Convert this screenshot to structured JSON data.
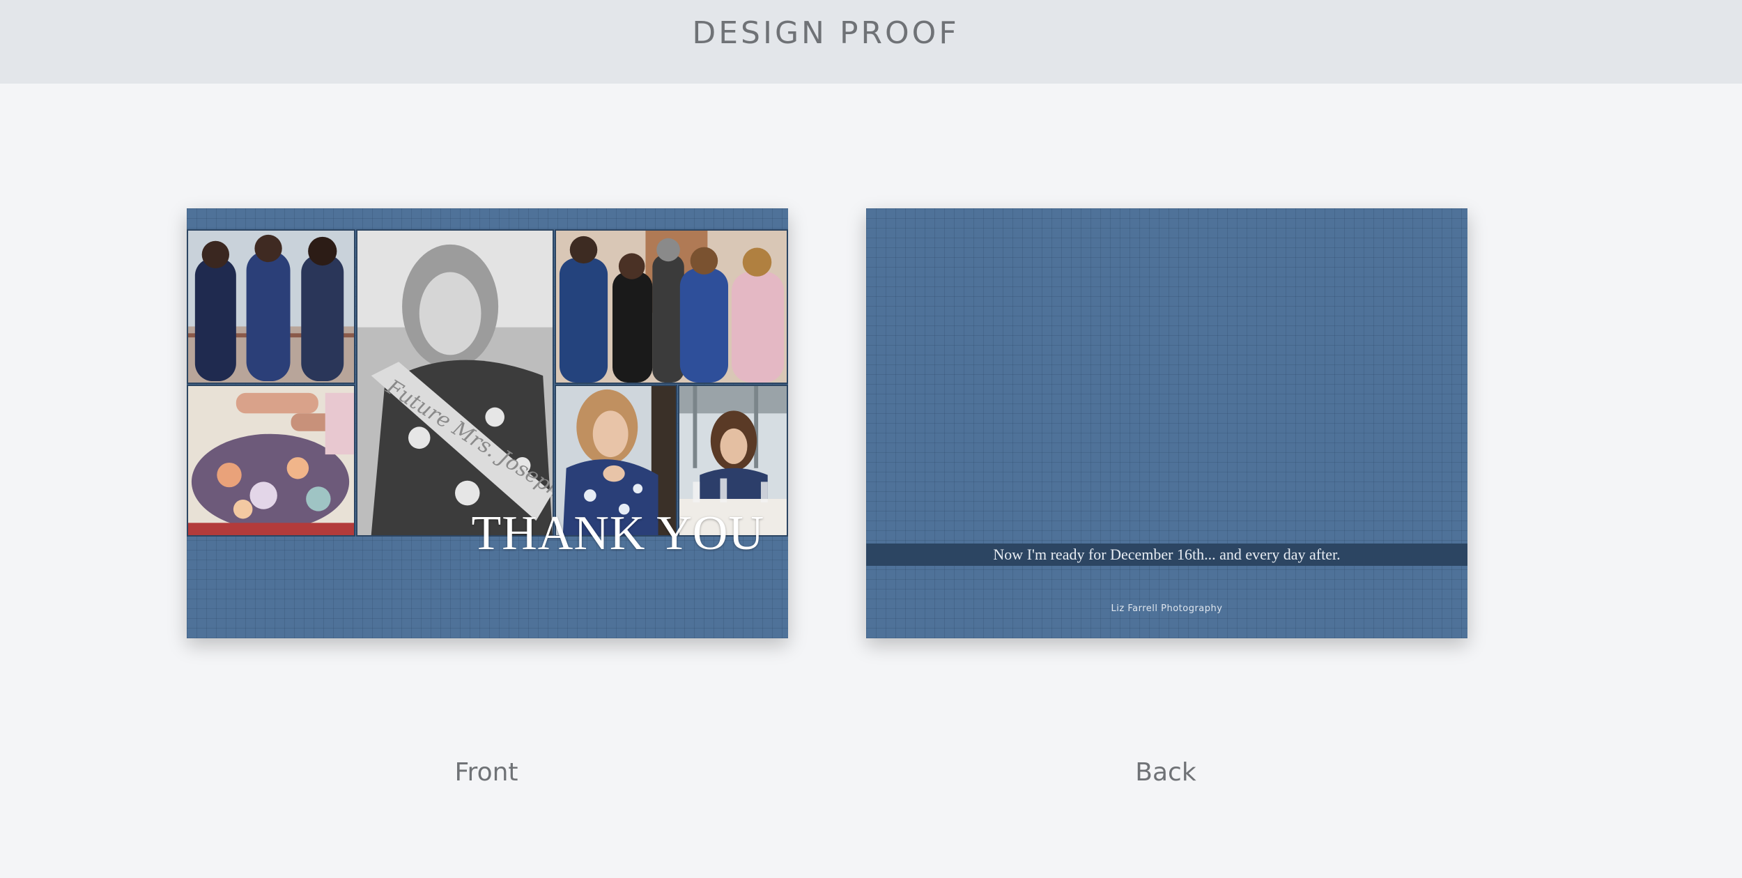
{
  "header": {
    "title": "DESIGN PROOF"
  },
  "front": {
    "label": "Front",
    "headline": "THANK YOU",
    "sash_text": "Future Mrs. Joseph",
    "photos": [
      "photo-three-women",
      "photo-bride-sash",
      "photo-family-group",
      "photo-gift-wrapping",
      "photo-bride-laughing",
      "photo-bride-at-table"
    ]
  },
  "back": {
    "label": "Back",
    "quote": "Now I'm ready for December 16th... and every day after.",
    "photographer": "Liz Farrell Photography"
  },
  "colors": {
    "card_blue": "#4f7299",
    "band_navy": "#2c4562",
    "header_bg": "#e3e6ea",
    "page_bg": "#f4f5f7"
  }
}
